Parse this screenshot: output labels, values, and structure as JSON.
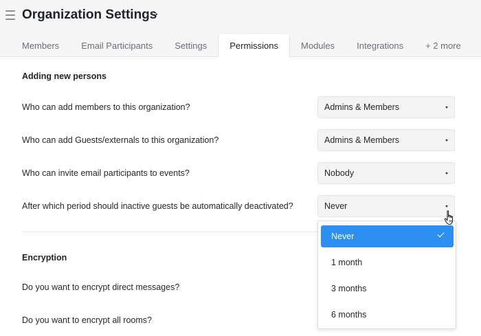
{
  "header": {
    "title": "Organization Settings",
    "more_label": "···",
    "tabs": [
      {
        "label": "Members",
        "active": false
      },
      {
        "label": "Email Participants",
        "active": false
      },
      {
        "label": "Settings",
        "active": false
      },
      {
        "label": "Permissions",
        "active": true
      },
      {
        "label": "Modules",
        "active": false
      },
      {
        "label": "Integrations",
        "active": false
      },
      {
        "label": "+ 2 more",
        "active": false
      }
    ]
  },
  "sections": {
    "adding": {
      "title": "Adding new persons",
      "rows": [
        {
          "question": "Who can add members to this organization?",
          "value": "Admins & Members"
        },
        {
          "question": "Who can add Guests/externals to this organization?",
          "value": "Admins & Members"
        },
        {
          "question": "Who can invite email participants to events?",
          "value": "Nobody"
        },
        {
          "question": "After which period should inactive guests be automatically deactivated?",
          "value": "Never"
        }
      ]
    },
    "encryption": {
      "title": "Encryption",
      "rows": [
        {
          "question": "Do you want to encrypt direct messages?"
        },
        {
          "question": "Do you want to encrypt all rooms?"
        }
      ]
    }
  },
  "dropdown": {
    "options": [
      {
        "label": "Never",
        "selected": true
      },
      {
        "label": "1 month",
        "selected": false
      },
      {
        "label": "3 months",
        "selected": false
      },
      {
        "label": "6 months",
        "selected": false
      }
    ]
  },
  "colors": {
    "accent": "#2d8ff0",
    "header_bg": "#f5f5f6",
    "select_bg": "#f3f3f4"
  },
  "icons": [
    "hamburger-menu-icon",
    "more-options-icon",
    "chevron-down-icon",
    "checkmark-icon",
    "hand-pointer-cursor-icon"
  ]
}
